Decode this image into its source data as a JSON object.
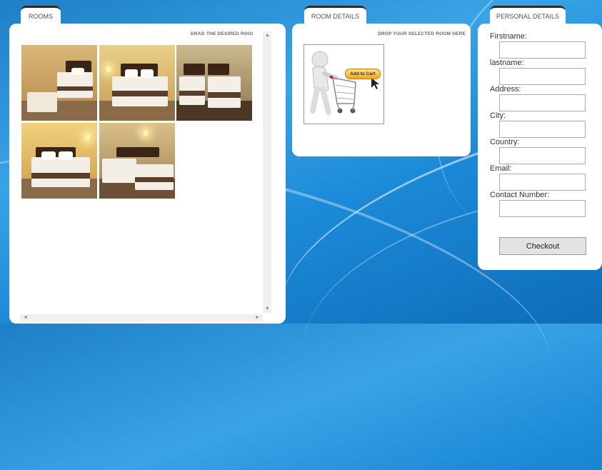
{
  "tabs": {
    "rooms": "ROOMS",
    "room_details": "ROOM DETAILS",
    "personal_details": "PERSONAL DETAILS"
  },
  "rooms_panel": {
    "hint": "DRAG THE DESIRED ROOI"
  },
  "details_panel": {
    "hint": "DROP YOUR SELECTED ROOM HERE",
    "cart_button_label": "Add to Cart"
  },
  "form": {
    "firstname_label": "Firstname:",
    "lastname_label": "lastname:",
    "address_label": "Address:",
    "city_label": "City:",
    "country_label": "Country:",
    "email_label": "Email:",
    "contact_label": "Contact Number:",
    "checkout_label": "Checkout"
  },
  "scroll": {
    "up": "▲",
    "down": "▼",
    "left": "◄",
    "right": "►"
  }
}
